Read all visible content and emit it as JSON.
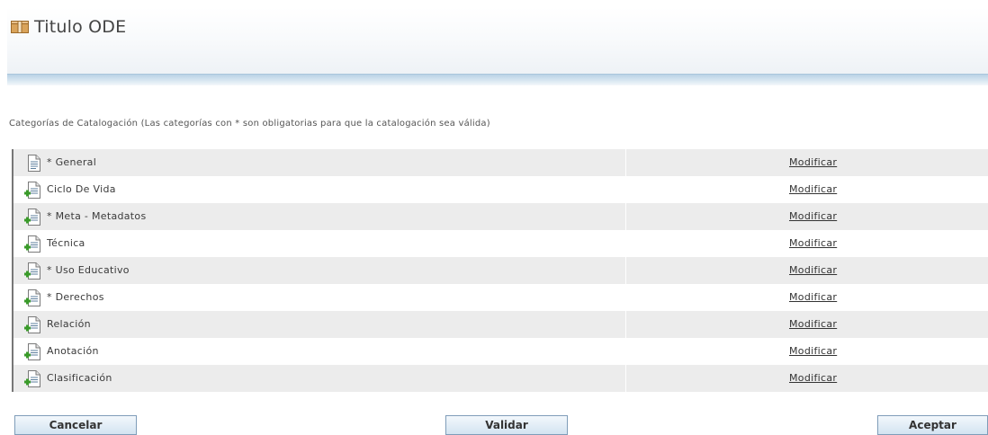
{
  "header": {
    "title": "Titulo ODE",
    "icon": "box-icon"
  },
  "section_label": "Categorías de Catalogación (Las categorías con * son obligatorias para que la catalogación sea válida)",
  "categories": [
    {
      "label": "* General",
      "link": "Modificar",
      "icon": "document-icon"
    },
    {
      "label": "Ciclo De Vida",
      "link": "Modificar",
      "icon": "document-add-icon"
    },
    {
      "label": "* Meta - Metadatos",
      "link": "Modificar",
      "icon": "document-add-icon"
    },
    {
      "label": "Técnica",
      "link": "Modificar",
      "icon": "document-add-icon"
    },
    {
      "label": "* Uso Educativo",
      "link": "Modificar",
      "icon": "document-add-icon"
    },
    {
      "label": "* Derechos",
      "link": "Modificar",
      "icon": "document-add-icon"
    },
    {
      "label": "Relación",
      "link": "Modificar",
      "icon": "document-add-icon"
    },
    {
      "label": "Anotación",
      "link": "Modificar",
      "icon": "document-add-icon"
    },
    {
      "label": "Clasificación",
      "link": "Modificar",
      "icon": "document-add-icon"
    }
  ],
  "buttons": {
    "cancel": "Cancelar",
    "validate": "Validar",
    "accept": "Aceptar"
  },
  "colors": {
    "row_odd": "#ececec",
    "row_even": "#ffffff",
    "header_band": "#b9d2e5",
    "button_border": "#7f9db9",
    "add_icon_green": "#3a9a2a"
  }
}
